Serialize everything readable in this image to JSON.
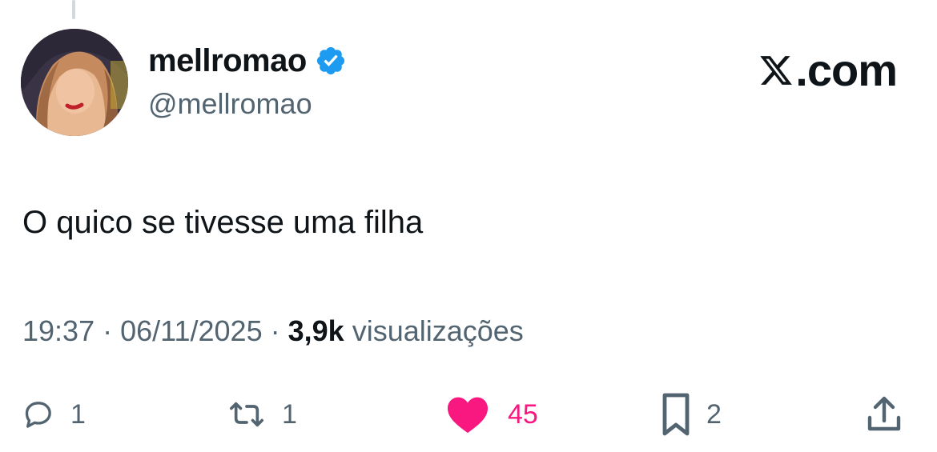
{
  "author": {
    "display_name": "mellromao",
    "handle": "@mellromao",
    "verified": true,
    "verified_color": "#1d9bf0"
  },
  "brand": {
    "text": ".com",
    "icon": "x-logo-icon"
  },
  "tweet": {
    "text": "O quico se tivesse uma filha"
  },
  "meta": {
    "time": "19:37",
    "separator_1": " · ",
    "date": "06/11/2025",
    "separator_2": " · ",
    "views_count": "3,9k",
    "views_label": " visualizações"
  },
  "actions": {
    "reply_count": "1",
    "retweet_count": "1",
    "like_count": "45",
    "bookmark_count": "2",
    "liked": true,
    "like_color": "#f91880"
  },
  "colors": {
    "text": "#0f1419",
    "secondary": "#536471",
    "thread_line": "#cfd9de"
  }
}
